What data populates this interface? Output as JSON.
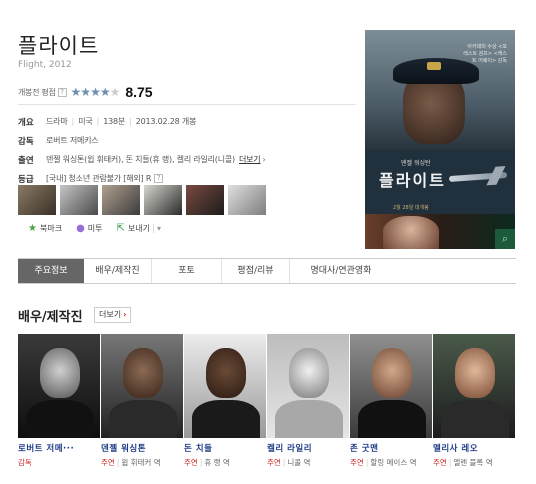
{
  "movie": {
    "title": "플라이트",
    "subtitle": "Flight, 2012",
    "rating_label": "개봉전 평점",
    "rating_help": "?",
    "rating_stars": 4.4,
    "score": "8.75"
  },
  "info": {
    "overview_label": "개요",
    "genre": "드라마",
    "country": "미국",
    "runtime": "138분",
    "release": "2013.02.28 개봉",
    "director_label": "감독",
    "director": "로버트 저메키스",
    "cast_label": "출연",
    "cast_text": "덴젤 워싱톤(윕 휘태커), 돈 치들(휴 랭), 켈리 라일리(니콜)",
    "cast_more": "더보기",
    "grade_label": "등급",
    "grade_text": "[국내] 청소년 관람불가 [해외] R",
    "grade_help": "?"
  },
  "actions": {
    "bookmark": "북마크",
    "like": "미투",
    "share": "보내기"
  },
  "poster": {
    "top_text": "아카데미 수상 <포레스트 검프> <캐스트 어웨이> 감독",
    "actor": "덴젤 워싱턴",
    "title": "플라이트",
    "date": "2월 28일 대개봉"
  },
  "tabs": [
    "주요정보",
    "배우/제작진",
    "포토",
    "평점/리뷰",
    "명대사/연관영화"
  ],
  "cast_section": {
    "title": "배우/제작진",
    "more": "더보기"
  },
  "cast": [
    {
      "name": "로버트 저메···",
      "role": "감독",
      "character": ""
    },
    {
      "name": "덴젤 워싱톤",
      "role": "주연",
      "character": "윕 휘태커 역"
    },
    {
      "name": "돈 치들",
      "role": "주연",
      "character": "휴 랭 역"
    },
    {
      "name": "켈리 라일리",
      "role": "주연",
      "character": "니콜 역"
    },
    {
      "name": "존 굿맨",
      "role": "주연",
      "character": "할링 메이스 역"
    },
    {
      "name": "멜리사 레오",
      "role": "주연",
      "character": "엘렌 블록 역"
    }
  ],
  "colors": {
    "accent_blue": "#1f3c88",
    "role_red": "#d12b2b",
    "tab_active": "#666666",
    "star_blue": "#6f8fb0"
  }
}
